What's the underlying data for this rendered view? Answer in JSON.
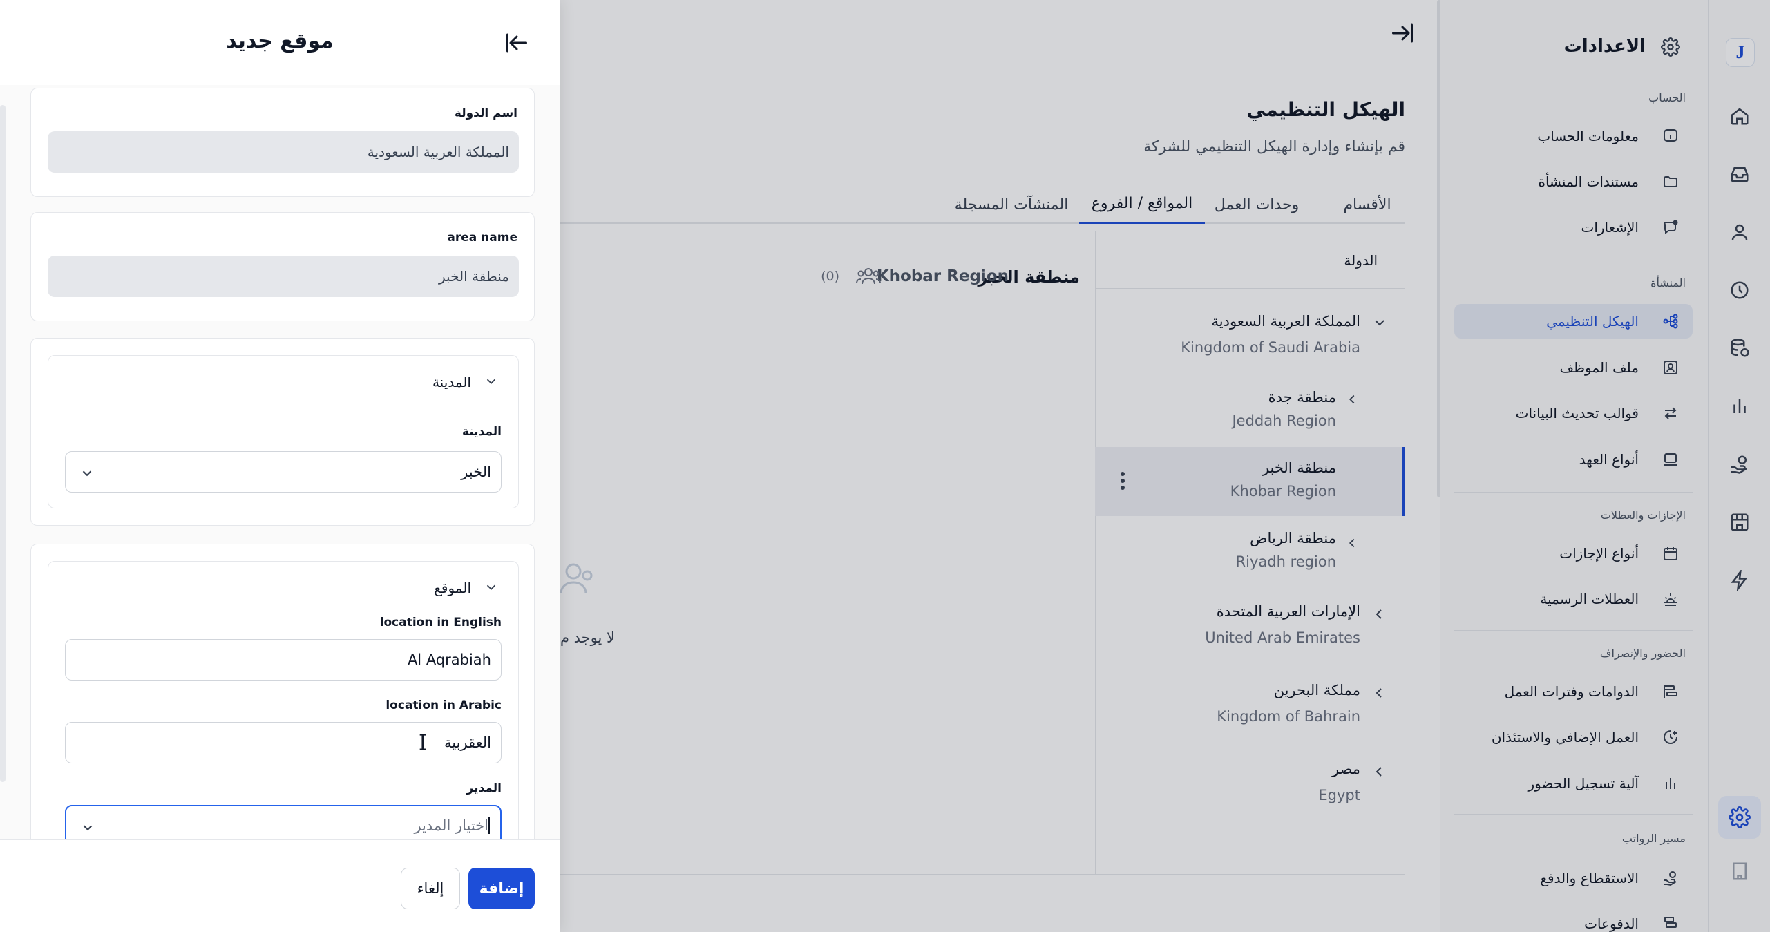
{
  "rail": {
    "logo": "J",
    "icons": [
      "home-icon",
      "inbox-icon",
      "user-icon",
      "clock-icon",
      "database-icon",
      "bar-chart-icon",
      "hand-coins-icon",
      "store-icon",
      "lightning-icon",
      "settings-icon",
      "building-icon"
    ]
  },
  "settings_nav": {
    "title": "الاعدادات",
    "sections": [
      {
        "label": "الحساب",
        "items": [
          {
            "label": "معلومات الحساب",
            "icon": "info-icon"
          },
          {
            "label": "مستندات المنشأة",
            "icon": "folder-icon"
          },
          {
            "label": "الإشعارات",
            "icon": "message-icon"
          }
        ]
      },
      {
        "label": "المنشأة",
        "items": [
          {
            "label": "الهيكل التنظيمي",
            "icon": "org-chart-icon",
            "active": true
          },
          {
            "label": "ملف الموظف",
            "icon": "id-card-icon"
          },
          {
            "label": "قوالب تحديث البيانات",
            "icon": "swap-icon"
          },
          {
            "label": "أنواع العهد",
            "icon": "laptop-icon"
          }
        ]
      },
      {
        "label": "الإجازات والعطلات",
        "items": [
          {
            "label": "أنواع الإجازات",
            "icon": "calendar-icon"
          },
          {
            "label": "العطلات الرسمية",
            "icon": "sunset-icon"
          }
        ]
      },
      {
        "label": "الحضور والإنصراف",
        "items": [
          {
            "label": "الدوامات وفترات العمل",
            "icon": "shifts-icon"
          },
          {
            "label": "العمل الإضافي والاستئذان",
            "icon": "clock-plus-icon"
          },
          {
            "label": "آلية تسجيل الحضور",
            "icon": "bar-chart-icon"
          }
        ]
      },
      {
        "label": "مسير الرواتب",
        "items": [
          {
            "label": "الاستقطاع والدفع",
            "icon": "hand-coins-icon"
          },
          {
            "label": "الدفوعات",
            "icon": "payments-icon"
          }
        ]
      }
    ]
  },
  "main": {
    "title": "الهيكل التنظيمي",
    "subtitle": "قم بإنشاء وإدارة الهيكل التنظيمي للشركة",
    "tabs": [
      {
        "label": "الأقسام"
      },
      {
        "label": "وحدات العمل"
      },
      {
        "label": "المواقع / الفروع",
        "active": true
      },
      {
        "label": "المنشآت المسجلة"
      }
    ],
    "tree": {
      "header": "الدولة",
      "nodes": [
        {
          "ar": "المملكة العربية السعودية",
          "en": "Kingdom of Saudi Arabia"
        },
        {
          "ar": "منطقة جدة",
          "en": "Jeddah Region"
        },
        {
          "ar": "منطقة الخبر",
          "en": "Khobar Region"
        },
        {
          "ar": "منطقة الرياض",
          "en": "Riyadh region"
        },
        {
          "ar": "الإمارات العربية المتحدة",
          "en": "United Arab Emirates"
        },
        {
          "ar": "مملكة البحرين",
          "en": "Kingdom of Bahrain"
        },
        {
          "ar": "مصر",
          "en": "Egypt"
        }
      ]
    },
    "detail": {
      "name_ar": "منطقة الخبر",
      "name_en": "Khobar Region",
      "count": "(0)",
      "empty_text": "لا يوجد م"
    }
  },
  "drawer": {
    "title": "موقع جديد",
    "country": {
      "label": "اسم الدولة",
      "value": "المملكة العربية السعودية"
    },
    "area": {
      "label": "area name",
      "value": "منطقة الخبر"
    },
    "city_section": {
      "title": "المدينة",
      "label": "المدينة",
      "value": "الخبر"
    },
    "location_section": {
      "title": "الموقع",
      "en_label": "location in English",
      "en_value": "Al Aqrabiah",
      "ar_label": "location in Arabic",
      "ar_value": "العقربية",
      "manager_label": "المدير",
      "manager_placeholder": "اختيار المدير"
    },
    "add_button": "إضافة",
    "cancel_button": "إلغاء"
  }
}
